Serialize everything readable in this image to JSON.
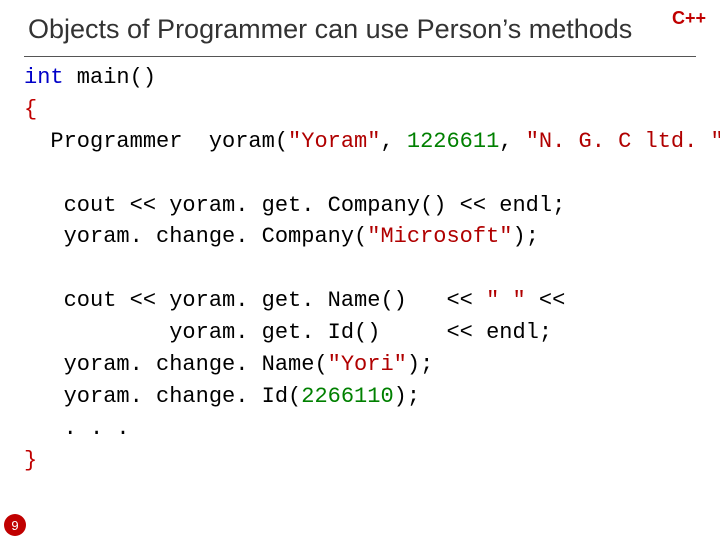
{
  "badge": "C++",
  "title": "Objects of Programmer can use Person’s methods",
  "page_number": "9",
  "code": {
    "l1_kw": "int",
    "l1_rest": " main()",
    "l2": "{",
    "l3_a": "  Programmer  yoram(",
    "l3_s1": "\"Yoram\"",
    "l3_b": ", ",
    "l3_n1": "1226611",
    "l3_c": ", ",
    "l3_s2": "\"N. G. C ltd. \"",
    "l3_d": ");",
    "blank1": " ",
    "l5_a": "   cout << yoram. get. Company() << endl;",
    "l6_a": "   yoram. change. Company(",
    "l6_s1": "\"Microsoft\"",
    "l6_b": ");",
    "blank2": " ",
    "l8_a": "   cout << yoram. get. Name()   << ",
    "l8_s1": "\" \"",
    "l8_b": " <<",
    "l9_a": "           yoram. get. Id()     << endl;",
    "l10_a": "   yoram. change. Name(",
    "l10_s1": "\"Yori\"",
    "l10_b": ");",
    "l11_a": "   yoram. change. Id(",
    "l11_n1": "2266110",
    "l11_b": ");",
    "l12": "   . . .",
    "l13": "}"
  }
}
